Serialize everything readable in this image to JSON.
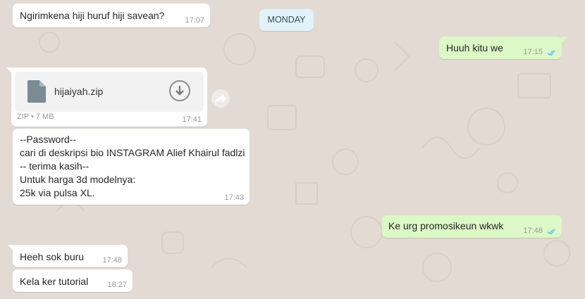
{
  "day_label": "MONDAY",
  "messages": [
    {
      "text": "Ngirimkena hiji huruf hiji savean?",
      "time": "17:07"
    },
    {
      "text": "Huuh kitu we",
      "time": "17:15"
    },
    {
      "file_name": "hijaiyah.zip",
      "file_meta": "ZIP • 7 MB",
      "time": "17:41"
    },
    {
      "lines": [
        "--Password--",
        "cari di deskripsi bio INSTAGRAM Alief Khairul fadlzi",
        "-- terima kasih--",
        "Untuk harga 3d modelnya:",
        "25k via pulsa XL."
      ],
      "time": "17:43"
    },
    {
      "text": "Ke urg promosikeun wkwk",
      "time": "17:48"
    },
    {
      "text": "Heeh sok buru",
      "time": "17:48"
    },
    {
      "text": "Kela ker tutorial",
      "time": "18:27"
    }
  ],
  "icons": {
    "file": "file-icon",
    "download": "download-icon",
    "forward": "forward-icon",
    "read_receipt": "double-check-icon"
  },
  "colors": {
    "incoming": "#ffffff",
    "outgoing": "#dcf8c6",
    "read_ticks": "#4fc3f7",
    "background": "#e5ddd5"
  }
}
